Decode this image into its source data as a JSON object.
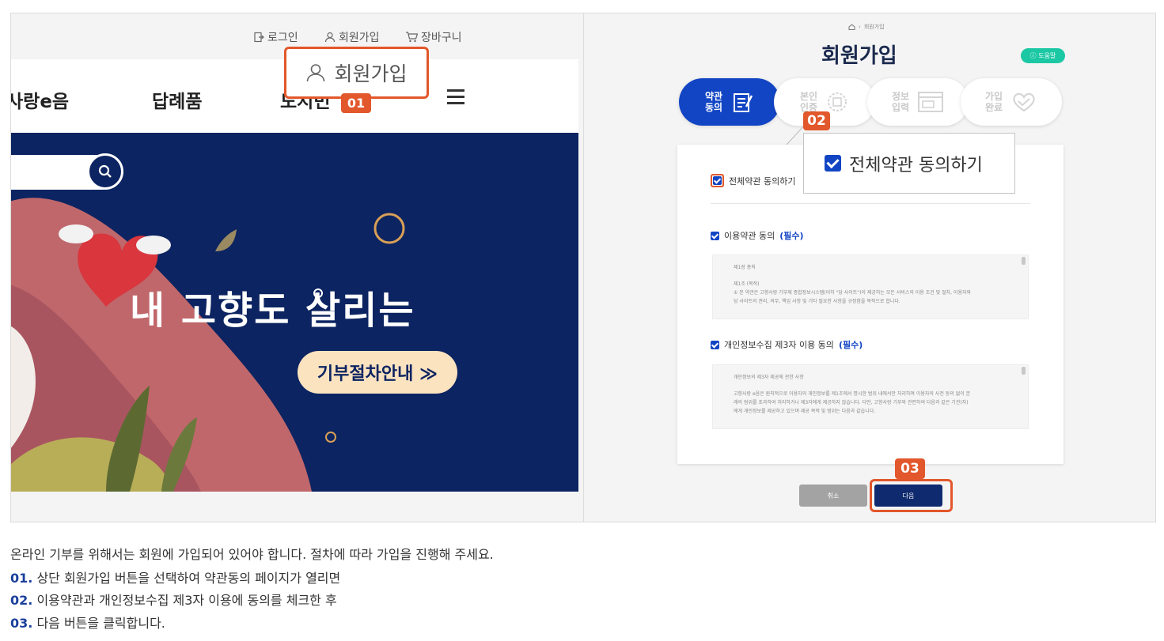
{
  "left_panel": {
    "top_links": [
      {
        "label": "로그인",
        "icon": "login-icon"
      },
      {
        "label": "회원가입",
        "icon": "user-icon"
      },
      {
        "label": "장바구니",
        "icon": "cart-icon"
      }
    ],
    "nav": [
      "사랑e음",
      "답례품"
    ],
    "hero_title": "내 고향도 살리는",
    "hero_button": "기부절차안내 ≫",
    "callout_label": "회원가입",
    "badge": "01"
  },
  "right_panel": {
    "title": "회원가입",
    "help_label": "도움말",
    "breadcrumb": "회원가입",
    "steps": [
      {
        "label_line1": "약관",
        "label_line2": "동의",
        "active": true,
        "icon": "document-sign-icon"
      },
      {
        "label_line1": "본인",
        "label_line2": "인증",
        "active": false,
        "icon": "badge-verify-icon"
      },
      {
        "label_line1": "정보",
        "label_line2": "입력",
        "active": false,
        "icon": "form-input-icon"
      },
      {
        "label_line1": "가입",
        "label_line2": "완료",
        "active": false,
        "icon": "heart-hands-icon"
      }
    ],
    "agree_all": "전체약관 동의하기",
    "terms1_label": "이용약관 동의",
    "terms2_label": "개인정보수집 제3자 이용 동의",
    "required": "(필수)",
    "terms1_text": {
      "heading": "제1장 총칙",
      "sub": "제1조 (목적)",
      "body": "① 본 약관은 고향사랑 기부제 종합정보시스템(이하 \"당 사이트\")이 제공하는 모든 서비스의 이용 조건 및 절차, 이용자와",
      "body2": "당 사이트의 권리, 의무, 책임 사항 및 기타 필요한 사항을 규정함을 목적으로 합니다."
    },
    "terms2_text": {
      "heading": "개인정보의 제3자 제공에 관한 사항",
      "body": "고향사랑 e음은 원칙적으로 이용자의 개인정보를 제1조에서 명시한 범위 내에서만 처리하며 이용자의 사전 동의 없이 본",
      "body2": "래의 범위를 초과하여 처리하거나 제3자에게 제공하지 않습니다. 다만, 고향사랑 기부와 관련하여 다음과 같은 기관(자)",
      "body3": "에게 개인정보를 제공하고 있으며 제공 목적 및 범위는 다음과 같습니다."
    },
    "callout_label": "전체약관 동의하기",
    "badge2": "02",
    "cancel_label": "취소",
    "next_label": "다음",
    "badge3": "03"
  },
  "description": {
    "intro": "온라인 기부를 위해서는 회원에 가입되어 있어야 합니다. 절차에 따라 가입을 진행해 주세요.",
    "steps": [
      {
        "num": "01.",
        "text": "상단 회원가입 버튼을 선택하여 약관동의 페이지가 열리면"
      },
      {
        "num": "02.",
        "text": "이용약관과 개인정보수집 제3자 이용에 동의를 체크한 후"
      },
      {
        "num": "03.",
        "text": "다음 버튼을 클릭합니다."
      }
    ]
  },
  "colors": {
    "accent": "#e2572b",
    "primary": "#1245c4",
    "navy": "#0c2461",
    "help": "#1cc8a4"
  }
}
